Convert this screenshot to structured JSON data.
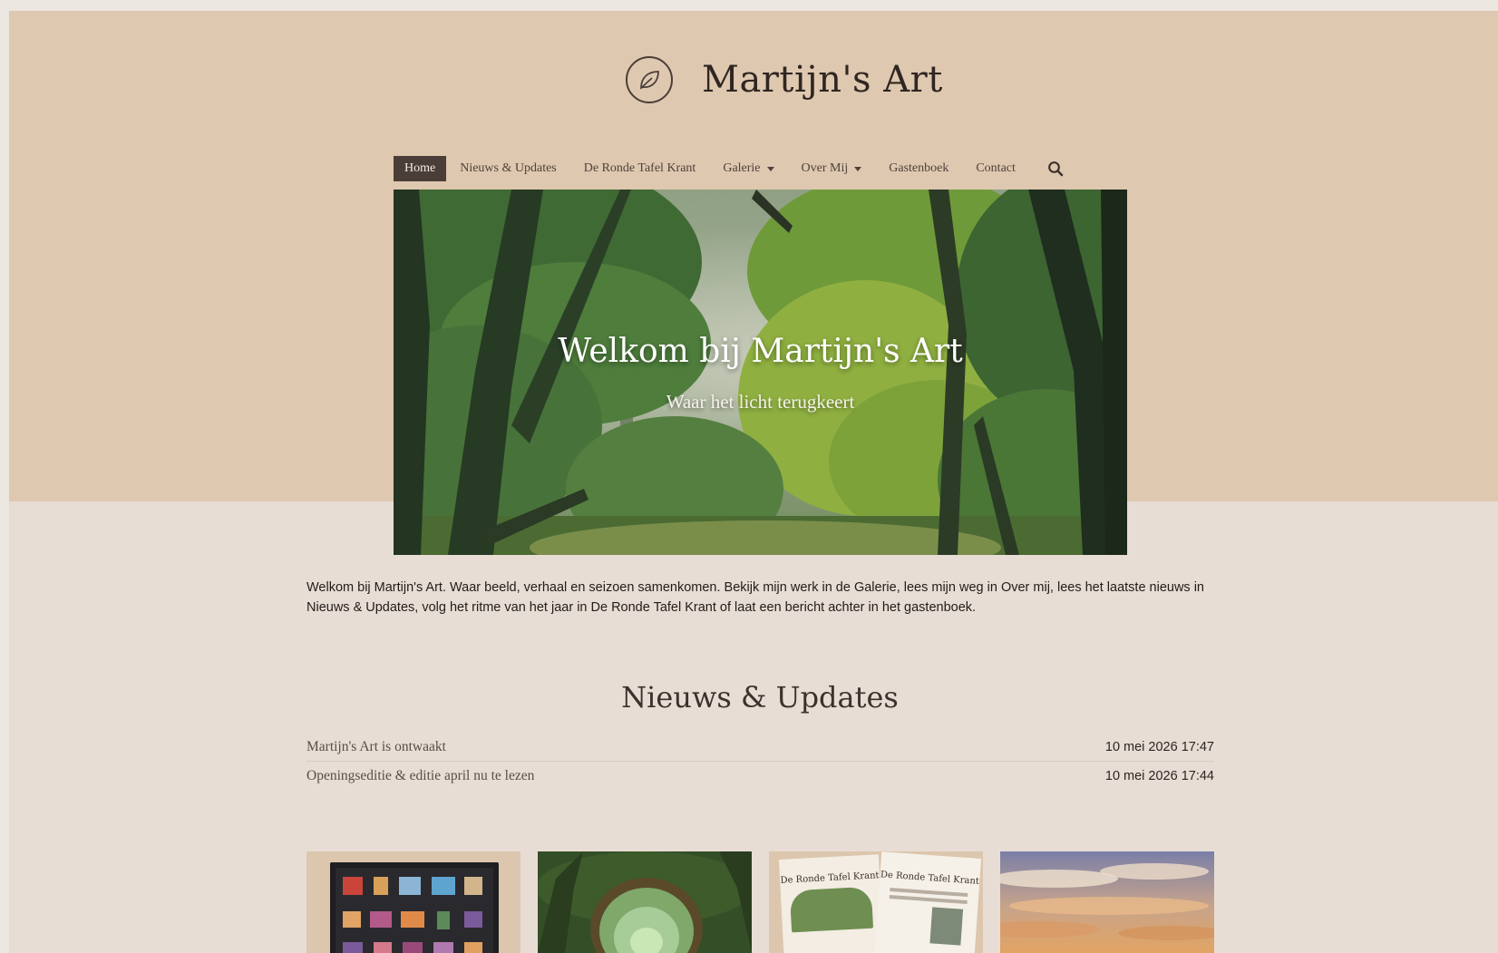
{
  "site": {
    "title": "Martijn's Art",
    "logo_icon": "leaf-icon"
  },
  "nav": {
    "items": [
      {
        "label": "Home",
        "active": true
      },
      {
        "label": "Nieuws & Updates"
      },
      {
        "label": "De Ronde Tafel Krant"
      },
      {
        "label": "Galerie",
        "dropdown": true
      },
      {
        "label": "Over Mij",
        "dropdown": true
      },
      {
        "label": "Gastenboek"
      },
      {
        "label": "Contact"
      }
    ],
    "search_icon": "search-icon"
  },
  "hero": {
    "title": "Welkom bij Martijn's Art",
    "subtitle": "Waar het licht terugkeert"
  },
  "intro": {
    "text": "Welkom bij Martijn's Art. Waar beeld, verhaal en seizoen samenkomen. Bekijk mijn werk in de Galerie, lees mijn weg in Over mij, lees het laatste nieuws in Nieuws & Updates, volg het ritme van het jaar in De Ronde Tafel Krant of laat een bericht achter in het gastenboek."
  },
  "news": {
    "heading": "Nieuws & Updates",
    "items": [
      {
        "title": "Martijn's Art is ontwaakt",
        "date": "10 mei 2026 17:47"
      },
      {
        "title": "Openingseditie & editie april nu te lezen",
        "date": "10 mei 2026 17:44"
      }
    ]
  },
  "thumbnails": {
    "krant_label": "De Ronde Tafel Krant"
  },
  "colors": {
    "top_band": "#dfc8b0",
    "bottom_band": "#e8ddd5",
    "nav_active": "#4b3e38"
  }
}
